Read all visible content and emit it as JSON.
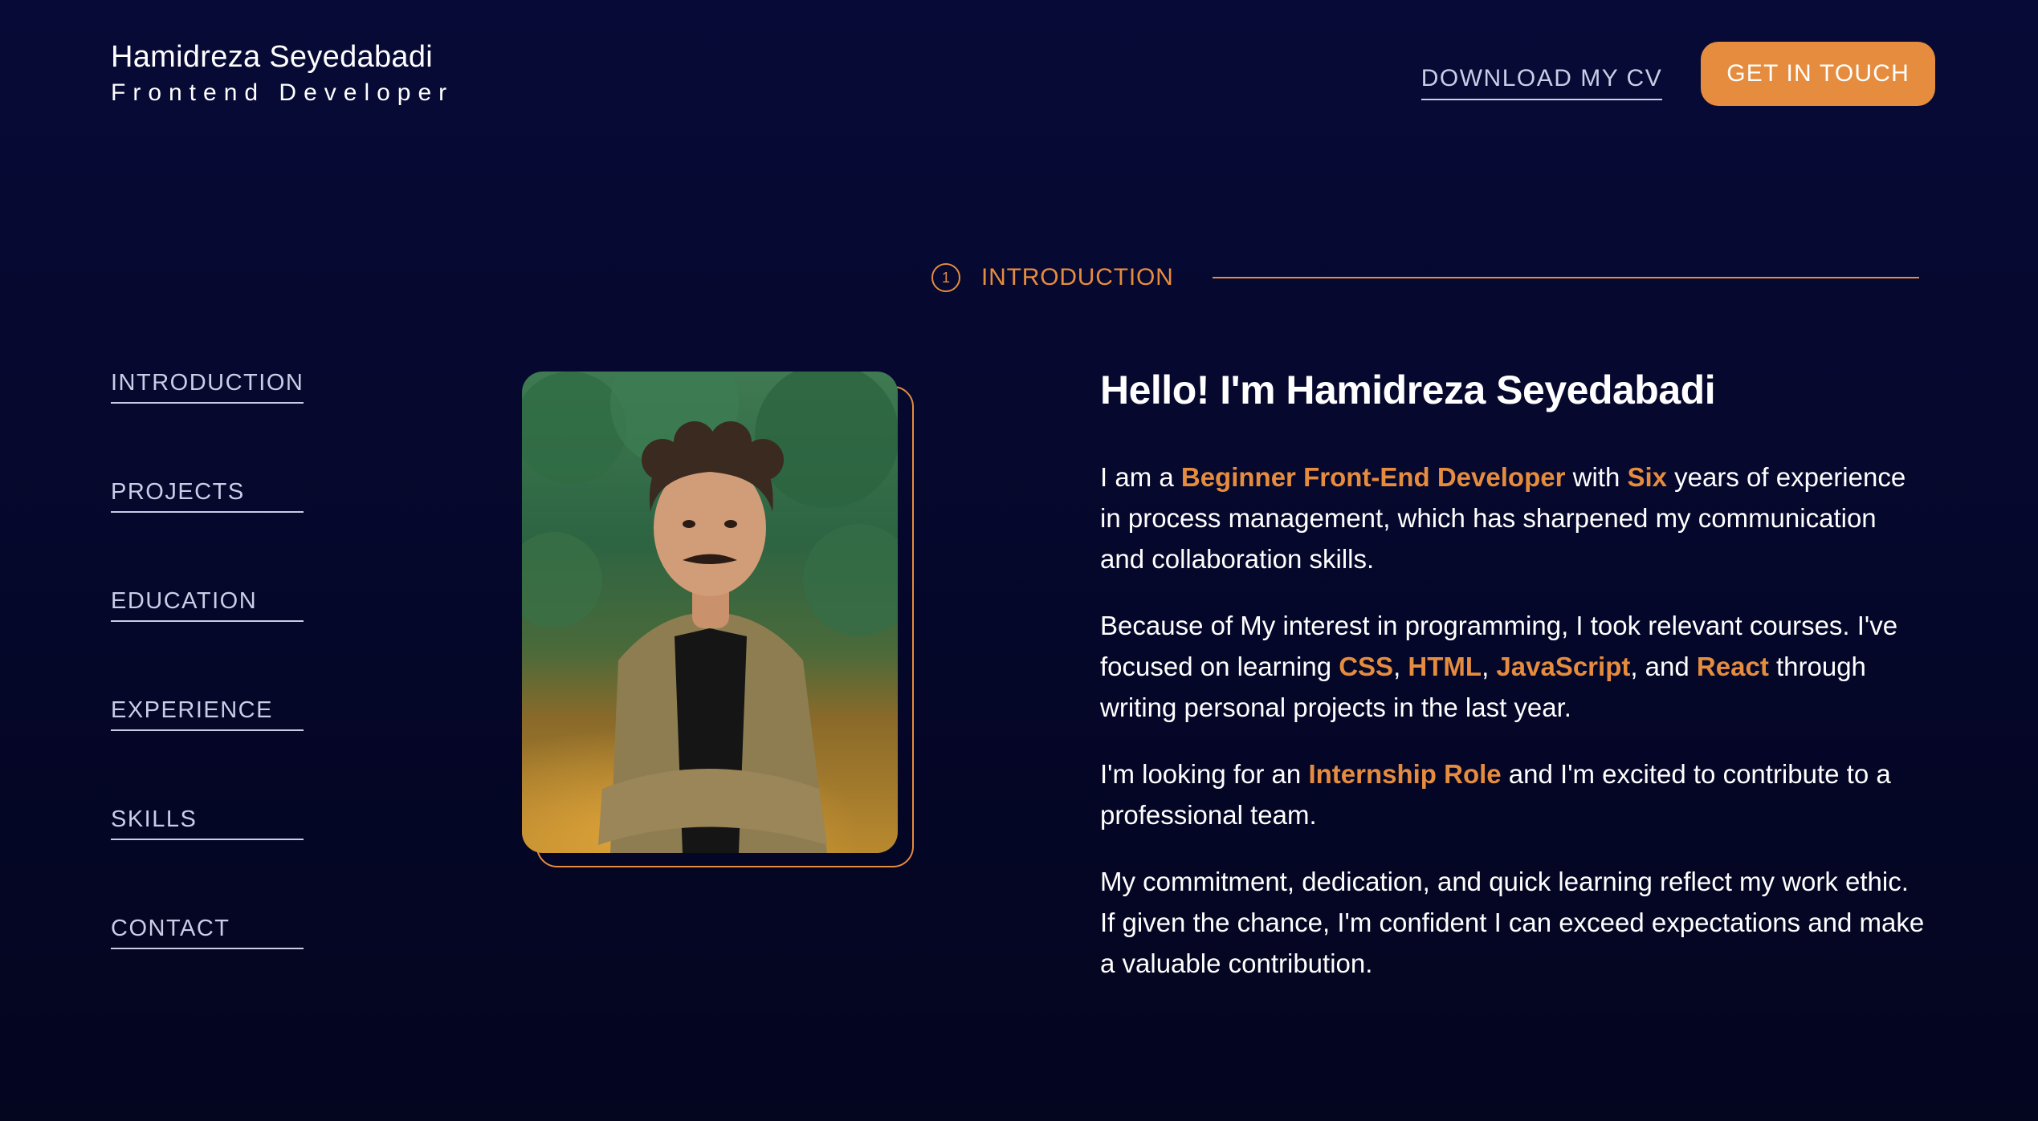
{
  "header": {
    "name": "Hamidreza Seyedabadi",
    "role": "Frontend Developer",
    "download_cv": "DOWNLOAD MY CV",
    "get_in_touch": "GET IN TOUCH"
  },
  "section": {
    "number": "1",
    "title": "INTRODUCTION"
  },
  "nav": {
    "items": [
      {
        "label": "INTRODUCTION"
      },
      {
        "label": "PROJECTS"
      },
      {
        "label": "EDUCATION"
      },
      {
        "label": "EXPERIENCE"
      },
      {
        "label": "SKILLS"
      },
      {
        "label": "CONTACT"
      }
    ]
  },
  "about": {
    "heading": "Hello! I'm Hamidreza Seyedabadi",
    "p1": {
      "t1": "I am a ",
      "h1": "Beginner Front-End Developer",
      "t2": " with ",
      "h2": "Six",
      "t3": " years of experience in process management, which has sharpened my communication and collaboration skills."
    },
    "p2": {
      "t1": "Because of My interest in programming, I took relevant courses. I've focused on learning ",
      "h1": "CSS",
      "t2": ", ",
      "h2": "HTML",
      "t3": ", ",
      "h3": "JavaScript",
      "t4": ", and ",
      "h4": "React",
      "t5": " through writing personal projects in the last year."
    },
    "p3": {
      "t1": "I'm looking for an ",
      "h1": "Internship Role",
      "t2": " and I'm excited to contribute to a professional team."
    },
    "p4": {
      "t1": "My commitment, dedication, and quick learning reflect my work ethic. If given the chance, I'm confident I can exceed expectations and make a valuable contribution."
    }
  },
  "colors": {
    "accent": "#e58c3e",
    "background": "#070a36",
    "nav_text": "#c9cde6"
  }
}
